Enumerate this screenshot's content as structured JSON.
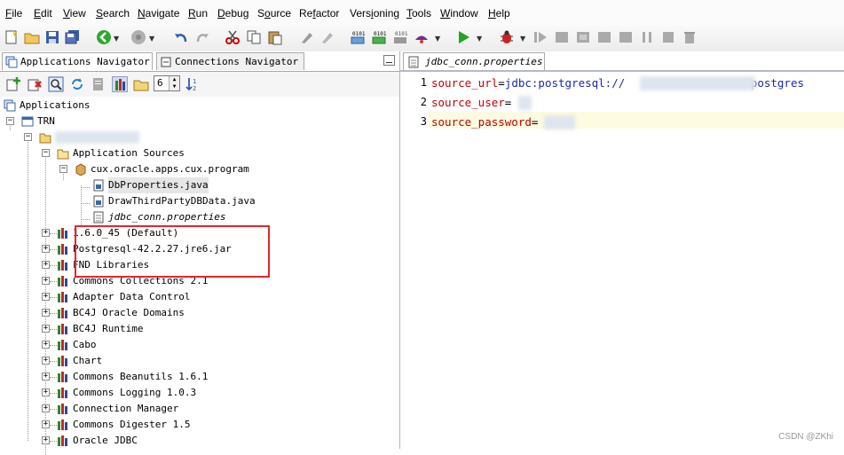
{
  "menu": [
    "File",
    "Edit",
    "View",
    "Search",
    "Navigate",
    "Run",
    "Debug",
    "Source",
    "Refactor",
    "Versioning",
    "Tools",
    "Window",
    "Help"
  ],
  "menu_mnemonic": [
    "F",
    "E",
    "V",
    "S",
    "N",
    "R",
    "D",
    "o",
    "f",
    "i",
    "T",
    "W",
    "H"
  ],
  "left_tabs": {
    "applications": "Applications Navigator",
    "connections": "Connections Navigator"
  },
  "nav_level": "6",
  "tree": {
    "root": "Applications",
    "app": "TRN",
    "application_sources": "Application Sources",
    "package": "cux.oracle.apps.cux.program",
    "files": [
      "DbProperties.java",
      "DrawThirdPartyDBData.java",
      "jdbc_conn.properties"
    ],
    "libraries": [
      "1.6.0_45 (Default)",
      "Postgresql-42.2.27.jre6.jar",
      "FND Libraries",
      "Commons Collections 2.1",
      "Adapter Data Control",
      "BC4J Oracle Domains",
      "BC4J Runtime",
      "Cabo",
      "Chart",
      "Commons Beanutils 1.6.1",
      "Commons Logging 1.0.3",
      "Connection Manager",
      "Commons Digester 1.5",
      "Oracle JDBC"
    ]
  },
  "editor": {
    "tab": "jdbc_conn.properties",
    "lines": [
      {
        "num": "1",
        "key": "source_url",
        "eq": "=",
        "value": "jdbc:postgresql://",
        "suffix": "/postgres"
      },
      {
        "num": "2",
        "key": "source_user",
        "eq": "=",
        "value": "",
        "suffix": ""
      },
      {
        "num": "3",
        "key": "source_password",
        "eq": "=",
        "value": "",
        "suffix": ""
      }
    ]
  },
  "watermark": "CSDN @ZKhi",
  "colors": {
    "key": "#c00000",
    "value": "#1a2aa8",
    "highlight_box": "#e0282d"
  }
}
